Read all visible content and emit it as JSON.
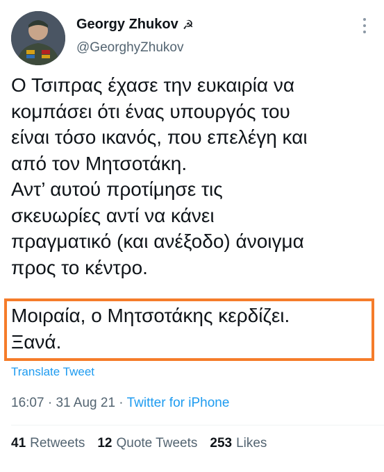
{
  "user": {
    "display_name": "Georgy Zhukov",
    "badge_icon": "hammer-and-sickle-icon",
    "badge_glyph": "☭",
    "handle": "@GeorghyZhukov"
  },
  "tweet": {
    "lines": [
      "Ο Τσιπρας έχασε την ευκαιρία να",
      "κομπάσει ότι ένας υπουργός του",
      "είναι τόσο ικανός, που επελέγη και",
      "από τον Μητσοτάκη.",
      "Αντ’ αυτού προτίμησε τις",
      "σκευωρίες αντί να κάνει",
      "πραγματικό (και ανέξοδο) άνοιγμα",
      "προς το κέντρο."
    ],
    "highlighted_lines": [
      "Μοιραία, ο Μητσοτάκης κερδίζει.",
      "Ξανά."
    ]
  },
  "translate_label": "Translate Tweet",
  "meta": {
    "time": "16:07",
    "separator1": " · ",
    "date": "31 Aug 21",
    "separator2": " · ",
    "source": "Twitter for iPhone"
  },
  "stats": {
    "retweets_count": "41",
    "retweets_label": "Retweets",
    "quote_count": "12",
    "quote_label": "Quote Tweets",
    "likes_count": "253",
    "likes_label": "Likes"
  },
  "colors": {
    "link": "#1d9bf0",
    "highlight_border": "#f57c2a",
    "secondary_text": "#536471"
  }
}
